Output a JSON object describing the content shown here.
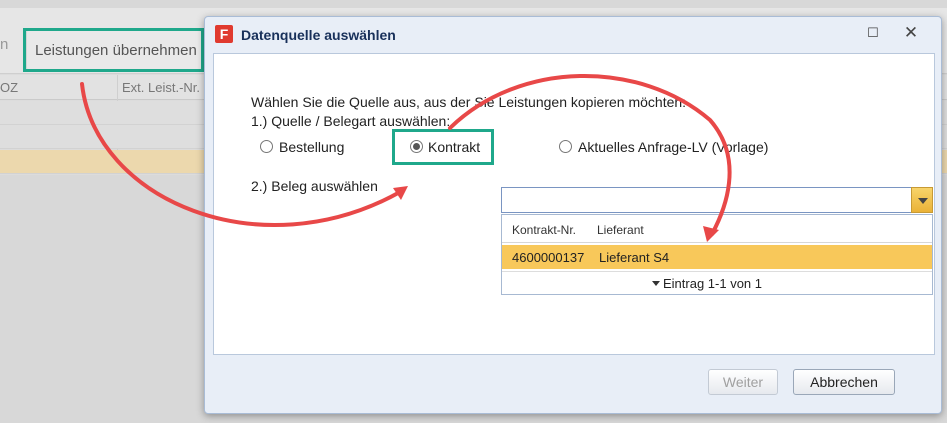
{
  "background": {
    "tab_cut_label": "n",
    "leistungen_button": "Leistungen übernehmen",
    "columns": [
      "OZ",
      "Ext. Leist.-Nr."
    ]
  },
  "dialog": {
    "logo_letter": "F",
    "title": "Datenquelle auswählen",
    "intro": "Wählen Sie die Quelle aus, aus der Sie Leistungen kopieren möchten:",
    "step1_label": "1.) Quelle / Belegart auswählen:",
    "radios": [
      {
        "label": "Bestellung",
        "checked": false
      },
      {
        "label": "Kontrakt",
        "checked": true
      },
      {
        "label": "Aktuelles Anfrage-LV (Vorlage)",
        "checked": false
      }
    ],
    "step2_label": "2.) Beleg auswählen",
    "combo_value": "",
    "dropdown": {
      "headers": [
        "Kontrakt-Nr.",
        "Lieferant"
      ],
      "rows": [
        {
          "nr": "4600000137",
          "lieferant": "Lieferant S4"
        }
      ],
      "paging": "Eintrag 1-1 von 1"
    },
    "buttons": {
      "next": "Weiter",
      "cancel": "Abbrechen"
    }
  },
  "colors": {
    "highlight": "#1fa88b",
    "arrow": "#e84848",
    "selected_row": "#f8c85a"
  }
}
